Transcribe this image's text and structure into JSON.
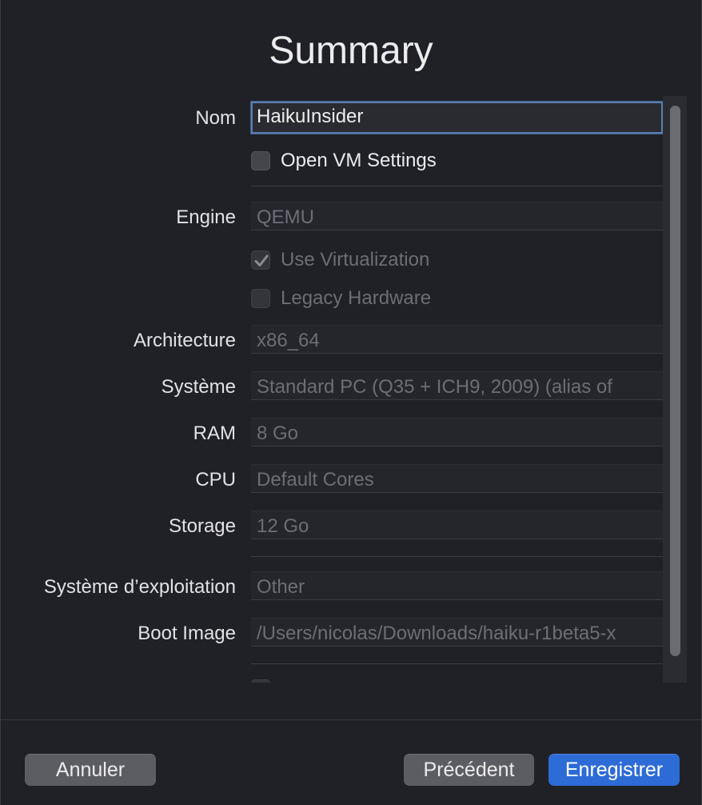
{
  "dialog": {
    "title": "Summary"
  },
  "form": {
    "name": {
      "label": "Nom",
      "value": "HaikuInsider"
    },
    "open_vm_settings": {
      "label": "Open VM Settings",
      "checked": false
    },
    "engine": {
      "label": "Engine",
      "value": "QEMU"
    },
    "use_virtualization": {
      "label": "Use Virtualization",
      "checked": true
    },
    "legacy_hardware": {
      "label": "Legacy Hardware",
      "checked": false
    },
    "architecture": {
      "label": "Architecture",
      "value": "x86_64"
    },
    "system": {
      "label": "Système",
      "value": "Standard PC (Q35 + ICH9, 2009) (alias of"
    },
    "ram": {
      "label": "RAM",
      "value": "8 Go"
    },
    "cpu": {
      "label": "CPU",
      "value": "Default Cores"
    },
    "storage": {
      "label": "Storage",
      "value": "12 Go"
    },
    "os": {
      "label": "Système d’exploitation",
      "value": "Other"
    },
    "boot_image": {
      "label": "Boot Image",
      "value": "/Users/nicolas/Downloads/haiku-r1beta5-x"
    }
  },
  "buttons": {
    "cancel": "Annuler",
    "previous": "Précédent",
    "save": "Enregistrer"
  },
  "colors": {
    "accent": "#2d6bd6",
    "focus_ring": "#5a7fb1",
    "background": "#202127"
  },
  "icons": {
    "checkmark": "checkmark-icon"
  }
}
